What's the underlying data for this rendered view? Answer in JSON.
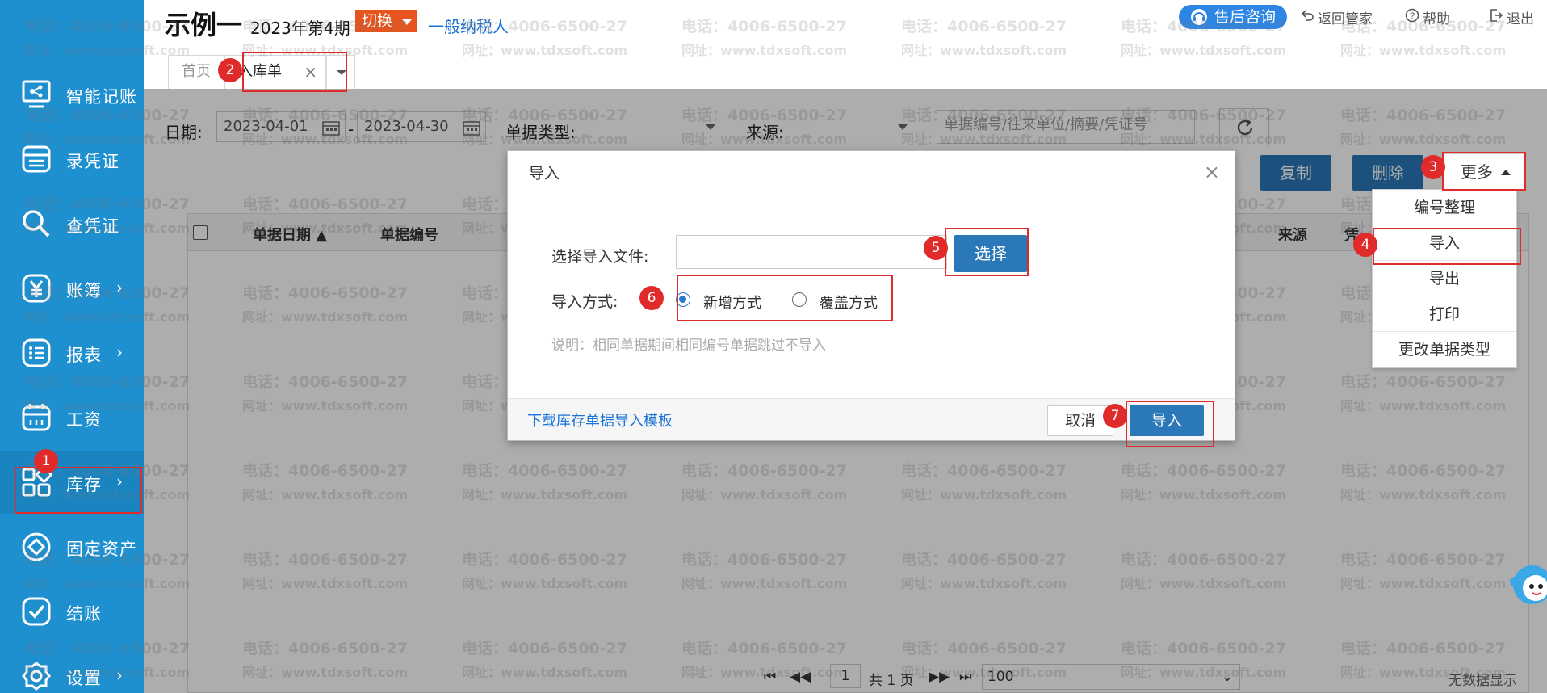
{
  "header": {
    "company": "示例一",
    "period": "2023年第4期",
    "switch_label": "切换",
    "taxpayer": "一般纳税人",
    "support_label": "售后咨询",
    "back_label": "返回管家",
    "help_label": "帮助",
    "logout_label": "退出"
  },
  "sidebar": {
    "items": [
      {
        "label": "智能记账",
        "icon": "smart-bookkeeping-icon"
      },
      {
        "label": "录凭证",
        "icon": "voucher-entry-icon"
      },
      {
        "label": "查凭证",
        "icon": "search-icon"
      },
      {
        "label": "账簿",
        "icon": "yen-icon"
      },
      {
        "label": "报表",
        "icon": "list-icon"
      },
      {
        "label": "工资",
        "icon": "calendar-icon"
      },
      {
        "label": "库存",
        "icon": "grid-icon"
      },
      {
        "label": "固定资产",
        "icon": "diamond-icon"
      },
      {
        "label": "结账",
        "icon": "check-icon"
      },
      {
        "label": "设置",
        "icon": "gear-icon"
      }
    ]
  },
  "tabs": {
    "home": "首页",
    "active": "入库单"
  },
  "filters": {
    "date_label": "日期:",
    "date_from": "2023-04-01",
    "date_sep": "-",
    "date_to": "2023-04-30",
    "type_label": "单据类型:",
    "source_label": "来源:",
    "search_placeholder": "单据编号/往来单位/摘要/凭证号"
  },
  "toolbar": {
    "copy": "复制",
    "delete": "删除",
    "more": "更多"
  },
  "more_menu": [
    "编号整理",
    "导入",
    "导出",
    "打印",
    "更改单据类型"
  ],
  "table": {
    "columns": [
      "单据日期",
      "单据编号",
      "来源",
      "凭"
    ]
  },
  "pager": {
    "page": "1",
    "total": "共 1 页",
    "page_size": "100",
    "empty": "无数据显示"
  },
  "modal": {
    "title": "导入",
    "file_label": "选择导入文件:",
    "select_button": "选择",
    "mode_label": "导入方式:",
    "mode_add": "新增方式",
    "mode_overwrite": "覆盖方式",
    "note": "说明：相同单据期间相同编号单据跳过不导入",
    "template_link": "下载库存单据导入模板",
    "cancel": "取消",
    "import": "导入"
  },
  "badges": [
    "1",
    "2",
    "3",
    "4",
    "5",
    "6",
    "7"
  ],
  "watermark": {
    "phone": "电话：4006-6500-27",
    "site": "网址：www.tdxsoft.com"
  },
  "colors": {
    "sidebar": "#1e8fcf",
    "primary_button": "#2a78b8",
    "accent_orange": "#e8541e",
    "highlight_red": "#e12b2b"
  }
}
